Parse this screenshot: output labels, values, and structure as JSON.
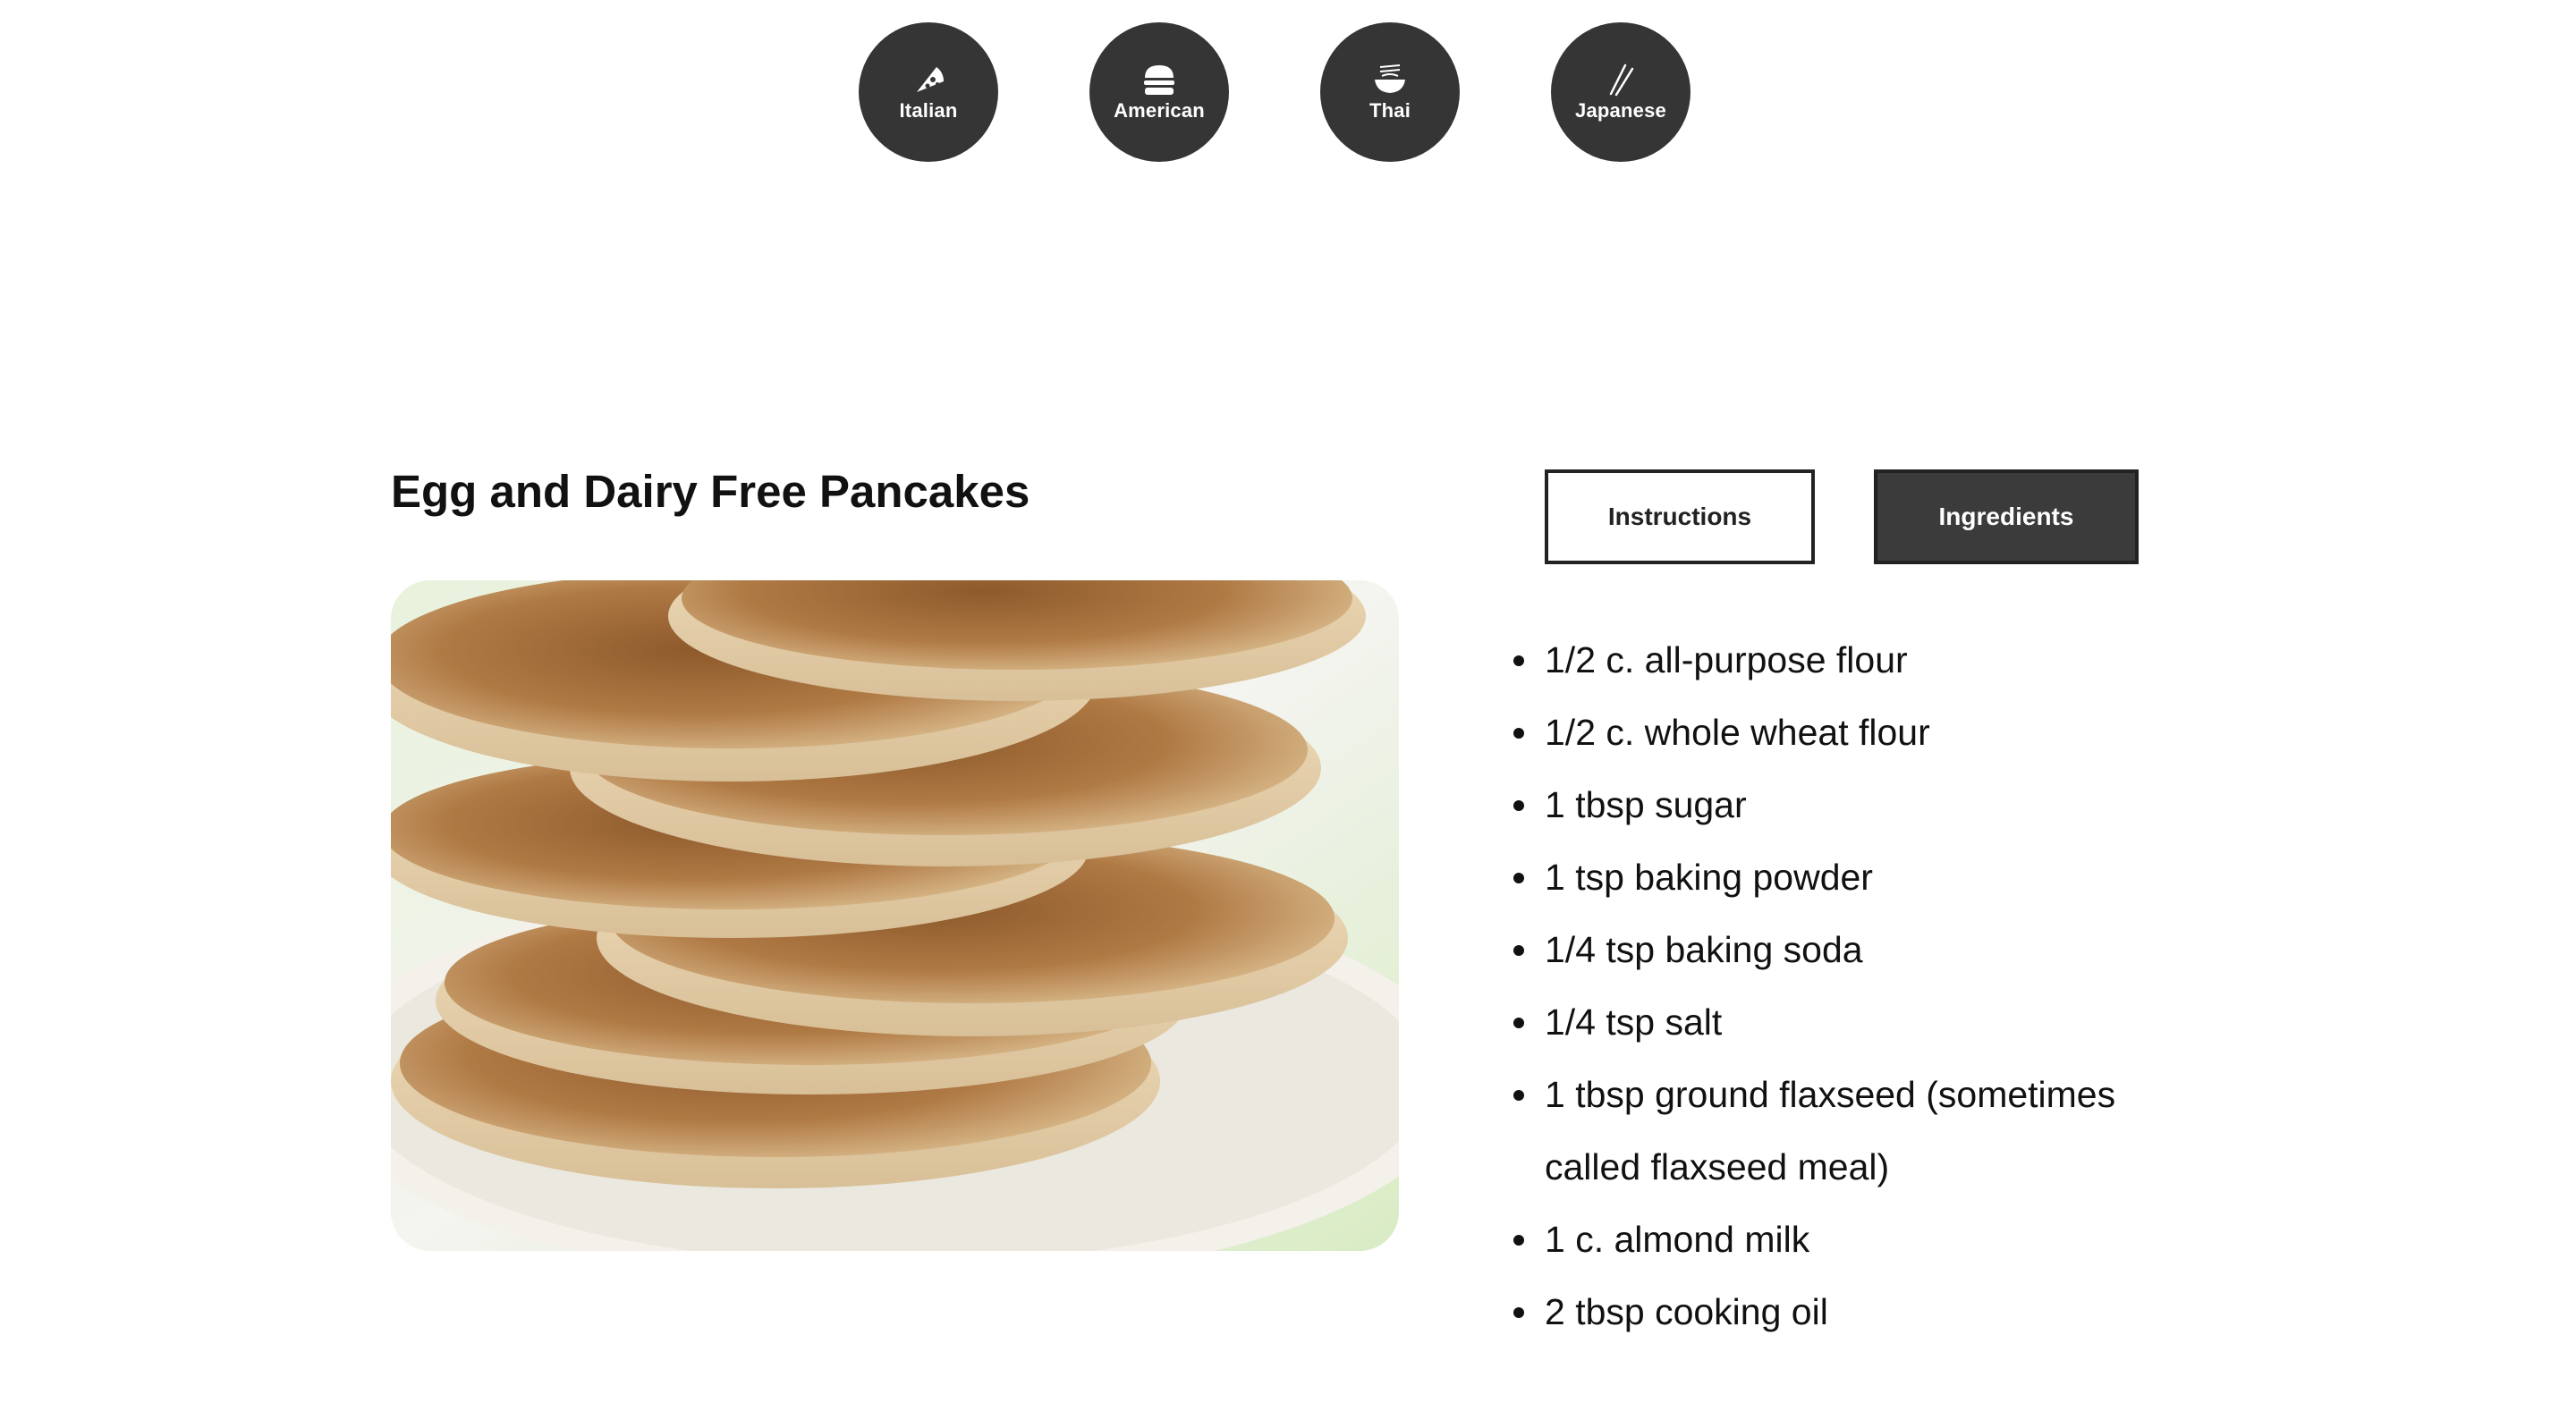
{
  "cuisines": [
    {
      "label": "Italian",
      "icon": "pizza-icon"
    },
    {
      "label": "American",
      "icon": "burger-icon"
    },
    {
      "label": "Thai",
      "icon": "noodle-bowl-icon"
    },
    {
      "label": "Japanese",
      "icon": "chopsticks-icon"
    }
  ],
  "recipe": {
    "title": "Egg and Dairy Free Pancakes",
    "image_alt": "Stack of pancakes on a plate"
  },
  "tabs": {
    "instructions_label": "Instructions",
    "ingredients_label": "Ingredients",
    "active": "Ingredients"
  },
  "ingredients": [
    "1/2 c. all-purpose flour",
    "1/2 c. whole wheat flour",
    "1 tbsp sugar",
    "1 tsp baking powder",
    "1/4 tsp baking soda",
    "1/4 tsp salt",
    "1 tbsp ground flaxseed (sometimes called flaxseed meal)",
    "1 c. almond milk",
    "2 tbsp cooking oil"
  ],
  "colors": {
    "nav_circle": "#353535",
    "active_tab": "#3b3b3b",
    "text": "#111111"
  }
}
